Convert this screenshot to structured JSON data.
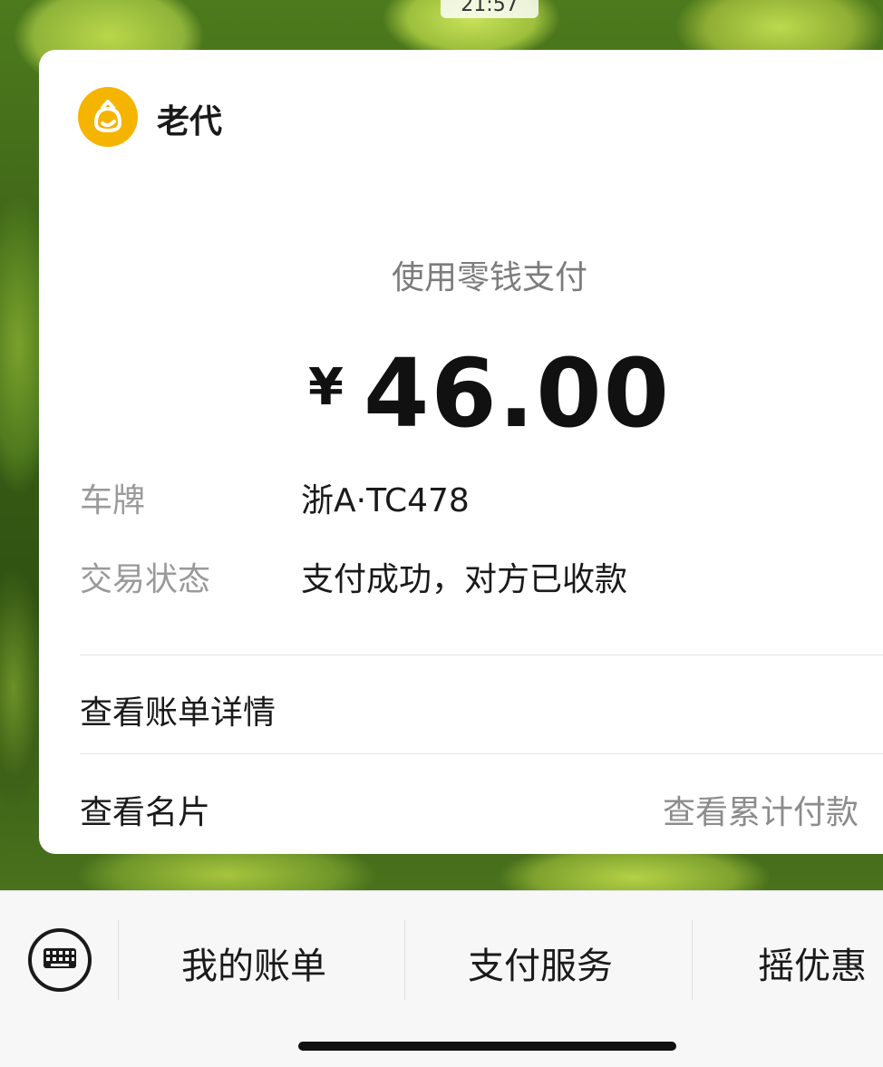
{
  "status_bar": {
    "time": "21:57"
  },
  "merchant": {
    "name": "老代",
    "logo_icon": "merchant-logo-icon",
    "logo_color": "#f5b400"
  },
  "payment": {
    "method": "使用零钱支付",
    "currency": "¥",
    "amount": "46.00"
  },
  "details": [
    {
      "label": "车牌",
      "value": "浙A·TC478"
    },
    {
      "label": "交易状态",
      "value": "支付成功，对方已收款"
    }
  ],
  "links": {
    "bill_details": "查看账单详情",
    "business_card": "查看名片",
    "cumulative_payments": "查看累计付款"
  },
  "bottom_menu": {
    "keyboard_icon": "keyboard-icon",
    "items": [
      "我的账单",
      "支付服务",
      "摇优惠"
    ]
  }
}
